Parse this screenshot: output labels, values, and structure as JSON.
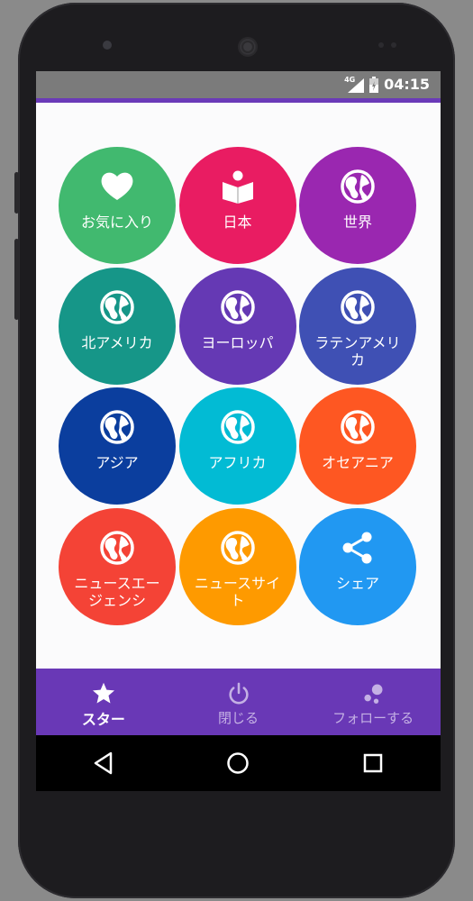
{
  "status_bar": {
    "network": "4G",
    "time": "04:15"
  },
  "menu": {
    "tiles": [
      {
        "label": "お気に入り",
        "icon": "heart-icon",
        "color": "#41b96f"
      },
      {
        "label": "日本",
        "icon": "book-reader-icon",
        "color": "#e91c62"
      },
      {
        "label": "世界",
        "icon": "globe-icon",
        "color": "#9a27b0"
      },
      {
        "label": "北アメリカ",
        "icon": "globe-icon",
        "color": "#169688"
      },
      {
        "label": "ヨーロッパ",
        "icon": "globe-icon",
        "color": "#6539b4"
      },
      {
        "label": "ラテンアメリカ",
        "icon": "globe-icon",
        "color": "#3f50b4"
      },
      {
        "label": "アジア",
        "icon": "globe-icon",
        "color": "#0b3e9e"
      },
      {
        "label": "アフリカ",
        "icon": "globe-icon",
        "color": "#02bbd4"
      },
      {
        "label": "オセアニア",
        "icon": "globe-icon",
        "color": "#fe5722"
      },
      {
        "label": "ニュースエージェンシ",
        "icon": "globe-icon",
        "color": "#f44336"
      },
      {
        "label": "ニュースサイト",
        "icon": "globe-icon",
        "color": "#fe9a00"
      },
      {
        "label": "シェア",
        "icon": "share-icon",
        "color": "#2198f2"
      }
    ]
  },
  "bottom_nav": {
    "items": [
      {
        "label": "スター",
        "icon": "star-icon",
        "active": true
      },
      {
        "label": "閉じる",
        "icon": "power-icon",
        "active": false
      },
      {
        "label": "フォローする",
        "icon": "follow-dots-icon",
        "active": false
      }
    ]
  },
  "colors": {
    "accent": "#6938b6",
    "status_bar": "#7b7b7b"
  }
}
